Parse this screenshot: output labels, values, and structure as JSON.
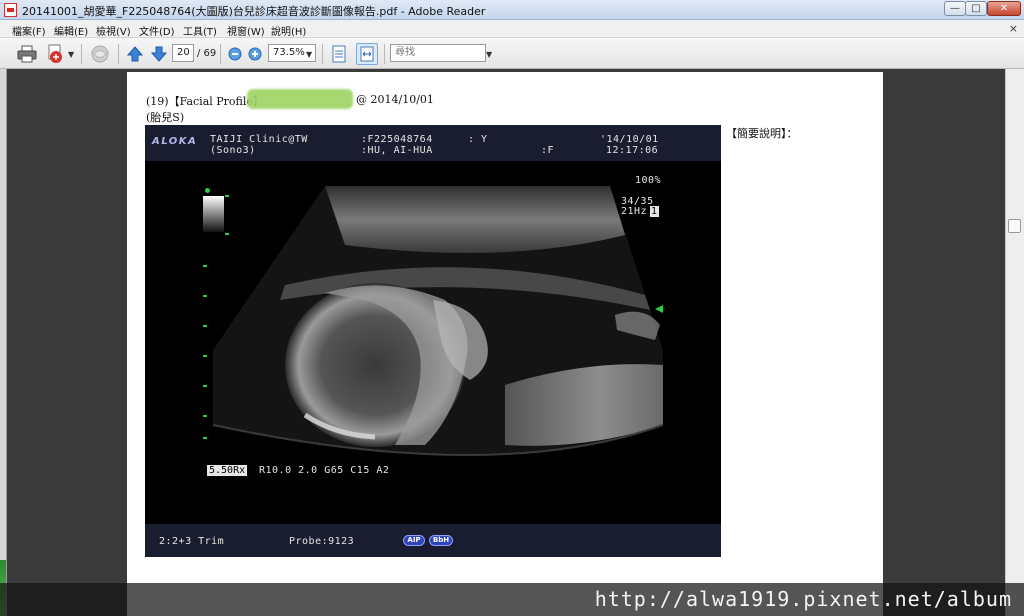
{
  "window": {
    "title": "20141001_胡愛華_F225048764(大圖版)台兒診床超音波診斷圖像報告.pdf - Adobe Reader",
    "minimize": "—",
    "maximize": "□",
    "close": "✕"
  },
  "menu": {
    "items": [
      "檔案(F)",
      "編輯(E)",
      "檢視(V)",
      "文件(D)",
      "工具(T)",
      "視窗(W)",
      "說明(H)"
    ],
    "close_glyph": "×"
  },
  "toolbar": {
    "page_current": "20",
    "page_total": "/ 69",
    "zoom": "73.5%",
    "search_placeholder": "尋找"
  },
  "document": {
    "heading_prefix": "(19)【Facial Profile】",
    "heading_date": "@ 2014/10/01",
    "subheading": "(胎兒S)",
    "summary_label": "【簡要說明】："
  },
  "ultrasound": {
    "brand": "ALOKA",
    "clinic": "TAIJI Clinic@TW",
    "mode": "(Sono3)",
    "patient_id": ":F225048764",
    "patient_name": ":HU, AI-HUA",
    "colon_y": ":    Y",
    "colon_f": ":F",
    "date": "'14/10/01",
    "time": "12:17:06",
    "gain_pct": "100%",
    "frame": "34/35",
    "rate": "21Hz",
    "rate_suffix": "1",
    "depth": "5.50Rx",
    "params": "R10.0 2.0 G65 C15 A2",
    "trim": "2:2+3 Trim",
    "probe": "Probe:9123",
    "pill_aip": "AIP",
    "pill_bbh": "BbH"
  },
  "watermark": {
    "text": "http://alwa1919.pixnet.net/album"
  }
}
